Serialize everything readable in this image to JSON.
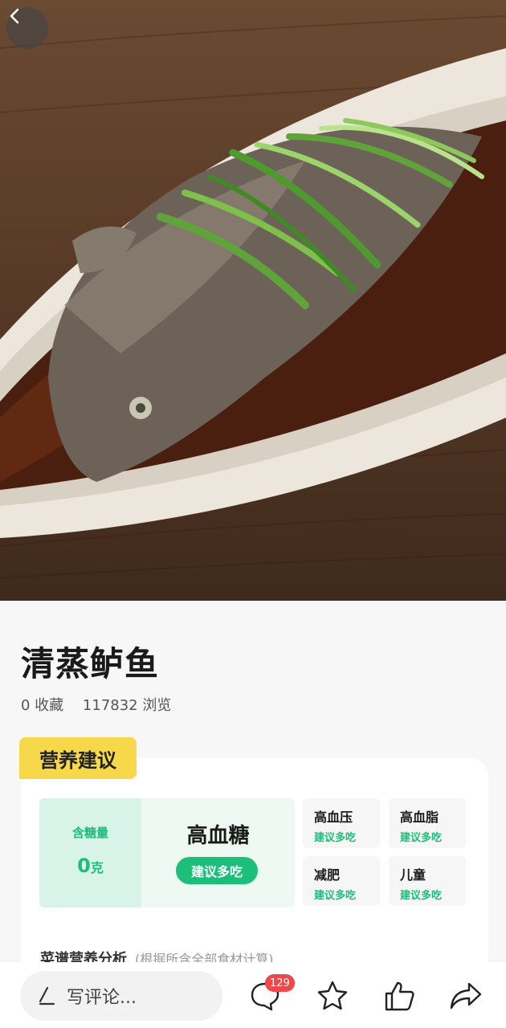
{
  "recipe": {
    "title": "清蒸鲈鱼",
    "favorites": "0 收藏",
    "views": "117832 浏览"
  },
  "nutrition": {
    "section_tag": "营养建议",
    "sugar_label": "含糖量",
    "sugar_value": "0",
    "sugar_unit": "克",
    "sugar_level": "高血糖",
    "sugar_advice": "建议多吃",
    "conditions": [
      {
        "name": "高血压",
        "advice": "建议多吃"
      },
      {
        "name": "高血脂",
        "advice": "建议多吃"
      },
      {
        "name": "减肥",
        "advice": "建议多吃"
      },
      {
        "name": "儿童",
        "advice": "建议多吃"
      }
    ],
    "analysis_title": "菜谱营养分析",
    "analysis_note": "(根据所含全部食材计算)"
  },
  "bottom_bar": {
    "comment_placeholder": "写评论...",
    "comment_count": "129"
  },
  "colors": {
    "accent_green": "#1bbf7a",
    "tag_yellow": "#f7d84b",
    "badge_red": "#f04848"
  },
  "icons": [
    "back-arrow-icon",
    "pen-icon",
    "comment-icon",
    "star-icon",
    "thumbs-up-icon",
    "share-icon"
  ]
}
